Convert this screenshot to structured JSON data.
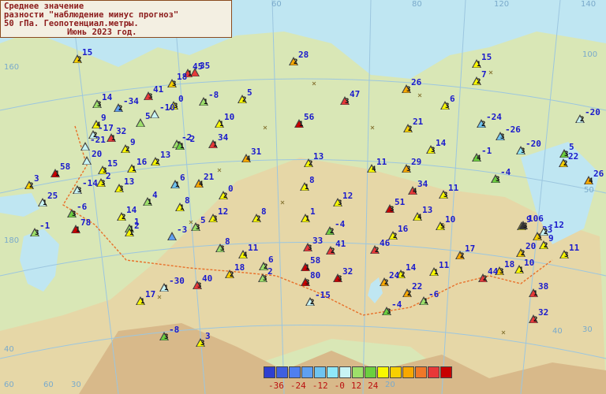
{
  "title_lines": [
    "Среднее значение",
    "разности \"наблюдение минус прогноз\"",
    "50 гПа. Геопотенциал.метры.",
    "Июнь  2023 год."
  ],
  "legend": {
    "colors": [
      "#2f3fd0",
      "#3f5fe0",
      "#4f7ff0",
      "#5fa0f0",
      "#6fc4f0",
      "#8fe8f8",
      "#c8f4f4",
      "#9de06a",
      "#6ccf3f",
      "#f8f800",
      "#f8d000",
      "#f8a800",
      "#f07828",
      "#e83838",
      "#c80000"
    ],
    "labels": [
      "-36",
      "-24",
      "-12",
      "-0",
      "12",
      "24"
    ]
  },
  "grid_labels": [
    "60",
    "80",
    "100",
    "120",
    "140",
    "160",
    "180",
    "40",
    "40",
    "60",
    "60",
    "30",
    "30",
    "50",
    "20",
    "20"
  ],
  "stations": [
    {
      "v": "15",
      "c": "2",
      "color": "#f8d000"
    },
    {
      "v": "35",
      "c": "",
      "color": "#e83838"
    },
    {
      "v": "45",
      "c": "1",
      "color": "#e83838"
    },
    {
      "v": "28",
      "c": "2",
      "color": "#f8a800"
    },
    {
      "v": "18",
      "c": "3",
      "color": "#f8d000"
    },
    {
      "v": "14",
      "c": "3",
      "color": "#9de06a"
    },
    {
      "v": "-34",
      "c": "2",
      "color": "#5fa0f0"
    },
    {
      "v": "41",
      "c": "3",
      "color": "#e83838"
    },
    {
      "v": "0",
      "c": "3",
      "color": "#f8f800"
    },
    {
      "v": "-8",
      "c": "1",
      "color": "#9de06a"
    },
    {
      "v": "5",
      "c": "2",
      "color": "#f8f800"
    },
    {
      "v": "-10",
      "c": "",
      "color": "#c8f4f4"
    },
    {
      "v": "5",
      "c": "",
      "color": "#9de06a"
    },
    {
      "v": "9",
      "c": "4",
      "color": "#f8f800"
    },
    {
      "v": "-2",
      "c": "1",
      "color": "#9de06a"
    },
    {
      "v": "10",
      "c": "1",
      "color": "#f8f800"
    },
    {
      "v": "56",
      "c": "1",
      "color": "#c80000"
    },
    {
      "v": "47",
      "c": "3",
      "color": "#e83838"
    },
    {
      "v": "26",
      "c": "3",
      "color": "#f8a800"
    },
    {
      "v": "15",
      "c": "1",
      "color": "#f8f800"
    },
    {
      "v": "7",
      "c": "2",
      "color": "#f8f800"
    },
    {
      "v": "6",
      "c": "3",
      "color": "#f8f800"
    },
    {
      "v": "-20",
      "c": "2",
      "color": "#c8f4f4"
    },
    {
      "v": "-17",
      "c": "2",
      "color": "#c8f4f4"
    },
    {
      "v": "32",
      "c": "1",
      "color": "#e83838"
    },
    {
      "v": "-21",
      "c": "",
      "color": "#c8f4f4"
    },
    {
      "v": "20",
      "c": "",
      "color": "#c8f4f4"
    },
    {
      "v": "9",
      "c": "2",
      "color": "#f8f800"
    },
    {
      "v": "-2",
      "c": "1",
      "color": "#6ccf3f"
    },
    {
      "v": "34",
      "c": "1",
      "color": "#e83838"
    },
    {
      "v": "13",
      "c": "2",
      "color": "#f8f800"
    },
    {
      "v": "31",
      "c": "4",
      "color": "#f8a800"
    },
    {
      "v": "21",
      "c": "2",
      "color": "#f8d000"
    },
    {
      "v": "-24",
      "c": "2",
      "color": "#6fc4f0"
    },
    {
      "v": "-26",
      "c": "3",
      "color": "#6fc4f0"
    },
    {
      "v": "14",
      "c": "3",
      "color": "#f8f800"
    },
    {
      "v": "-1",
      "c": "4",
      "color": "#6ccf3f"
    },
    {
      "v": "-20",
      "c": "3",
      "color": "#8fe8f8"
    },
    {
      "v": "5",
      "c": "3",
      "color": "#6ccf3f"
    },
    {
      "v": "22",
      "c": "2",
      "color": "#f8d000"
    },
    {
      "v": "58",
      "c": "1",
      "color": "#c80000"
    },
    {
      "v": "15",
      "c": "3",
      "color": "#f8f800"
    },
    {
      "v": "16",
      "c": "1",
      "color": "#f8f800"
    },
    {
      "v": "13",
      "c": "2",
      "color": "#f8f800"
    },
    {
      "v": "29",
      "c": "3",
      "color": "#f8a800"
    },
    {
      "v": "11",
      "c": "4",
      "color": "#f8f800"
    },
    {
      "v": "-4",
      "c": "3",
      "color": "#6ccf3f"
    },
    {
      "v": "26",
      "c": "4",
      "color": "#f8a800"
    },
    {
      "v": "3",
      "c": "2",
      "color": "#f8d000"
    },
    {
      "v": "-14",
      "c": "3",
      "color": "#c8f4f4"
    },
    {
      "v": "2",
      "c": "3",
      "color": "#f8f800"
    },
    {
      "v": "13",
      "c": "3",
      "color": "#f8f800"
    },
    {
      "v": "6",
      "c": "1",
      "color": "#6fc4f0"
    },
    {
      "v": "21",
      "c": "4",
      "color": "#f8a800"
    },
    {
      "v": "8",
      "c": "1",
      "color": "#f8f800"
    },
    {
      "v": "34",
      "c": "4",
      "color": "#e83838"
    },
    {
      "v": "11",
      "c": "3",
      "color": "#f8f800"
    },
    {
      "v": "25",
      "c": "1",
      "color": "#c8f4f4"
    },
    {
      "v": "4",
      "c": "1",
      "color": "#9de06a"
    },
    {
      "v": "0",
      "c": "2",
      "color": "#f8f800"
    },
    {
      "v": "12",
      "c": "3",
      "color": "#f8f800"
    },
    {
      "v": "51",
      "c": "3",
      "color": "#c80000"
    },
    {
      "v": "13",
      "c": "4",
      "color": "#f8f800"
    },
    {
      "v": "10",
      "c": "5",
      "color": "#f8f800"
    },
    {
      "v": "9",
      "c": "2",
      "color": "#f8f800"
    },
    {
      "v": "1",
      "c": "1",
      "color": "#f8f800"
    },
    {
      "v": "23",
      "c": "3",
      "color": "#f8d000"
    },
    {
      "v": "14",
      "c": "2",
      "color": "#f8f800"
    },
    {
      "v": "8",
      "c": "1",
      "color": "#f8f800"
    },
    {
      "v": "12",
      "c": "3",
      "color": "#f8f800"
    },
    {
      "v": "8",
      "c": "2",
      "color": "#f8f800"
    },
    {
      "v": "1",
      "c": "1",
      "color": "#9de06a"
    },
    {
      "v": "-6",
      "c": "3",
      "color": "#6ccf3f"
    },
    {
      "v": "78",
      "c": "1",
      "color": "#c80000"
    },
    {
      "v": "2",
      "c": "1",
      "color": "#f8f800"
    },
    {
      "v": "5",
      "c": "3",
      "color": "#9de06a"
    },
    {
      "v": "-3",
      "c": "",
      "color": "#5fa0f0"
    },
    {
      "v": "-4",
      "c": "2",
      "color": "#6ccf3f"
    },
    {
      "v": "16",
      "c": "2",
      "color": "#f8f800"
    },
    {
      "v": "-1",
      "c": "3",
      "color": "#9de06a"
    },
    {
      "v": "8",
      "c": "3",
      "color": "#9de06a"
    },
    {
      "v": "11",
      "c": "4",
      "color": "#f8f800"
    },
    {
      "v": "33",
      "c": "3",
      "color": "#e83838"
    },
    {
      "v": "41",
      "c": "2",
      "color": "#e83838"
    },
    {
      "v": "46",
      "c": "2",
      "color": "#e83838"
    },
    {
      "v": "20",
      "c": "2",
      "color": "#f8d000"
    },
    {
      "v": "11",
      "c": "3",
      "color": "#f8f800"
    },
    {
      "v": "6",
      "c": "2",
      "color": "#9de06a"
    },
    {
      "v": "58",
      "c": "1",
      "color": "#c80000"
    },
    {
      "v": "17",
      "c": "2",
      "color": "#f8a800"
    },
    {
      "v": "14",
      "c": "2",
      "color": "#f8f800"
    },
    {
      "v": "11",
      "c": "1",
      "color": "#f8f800"
    },
    {
      "v": "18",
      "c": "3",
      "color": "#f8d000"
    },
    {
      "v": "10",
      "c": "1",
      "color": "#f8f800"
    },
    {
      "v": "18",
      "c": "2",
      "color": "#f8d000"
    },
    {
      "v": "2",
      "c": "3",
      "color": "#9de06a"
    },
    {
      "v": "80",
      "c": "3",
      "color": "#c80000"
    },
    {
      "v": "32",
      "c": "3",
      "color": "#c80000"
    },
    {
      "v": "24",
      "c": "2",
      "color": "#f8a800"
    },
    {
      "v": "44",
      "c": "2",
      "color": "#e83838"
    },
    {
      "v": "-30",
      "c": "1",
      "color": "#c8f4f4"
    },
    {
      "v": "40",
      "c": "3",
      "color": "#e83838"
    },
    {
      "v": "22",
      "c": "2",
      "color": "#f8a800"
    },
    {
      "v": "38",
      "c": "1",
      "color": "#e83838"
    },
    {
      "v": "17",
      "c": "1",
      "color": "#f8f800"
    },
    {
      "v": "-15",
      "c": "2",
      "color": "#c8f4f4"
    },
    {
      "v": "-6",
      "c": "1",
      "color": "#9de06a"
    },
    {
      "v": "-4",
      "c": "3",
      "color": "#6ccf3f"
    },
    {
      "v": "32",
      "c": "2",
      "color": "#e83838"
    },
    {
      "v": "-8",
      "c": "3",
      "color": "#6ccf3f"
    },
    {
      "v": "3",
      "c": "3",
      "color": "#f8f800"
    },
    {
      "v": "106",
      "c": "3",
      "color": "#333"
    },
    {
      "v": "-12",
      "c": "2",
      "color": "#c8f4f4"
    },
    {
      "v": "9",
      "c": "2",
      "color": "#f8f800"
    },
    {
      "v": "1",
      "c": "",
      "color": "#f8f800"
    },
    {
      "v": "5",
      "c": "1",
      "color": "#9de06a"
    }
  ]
}
